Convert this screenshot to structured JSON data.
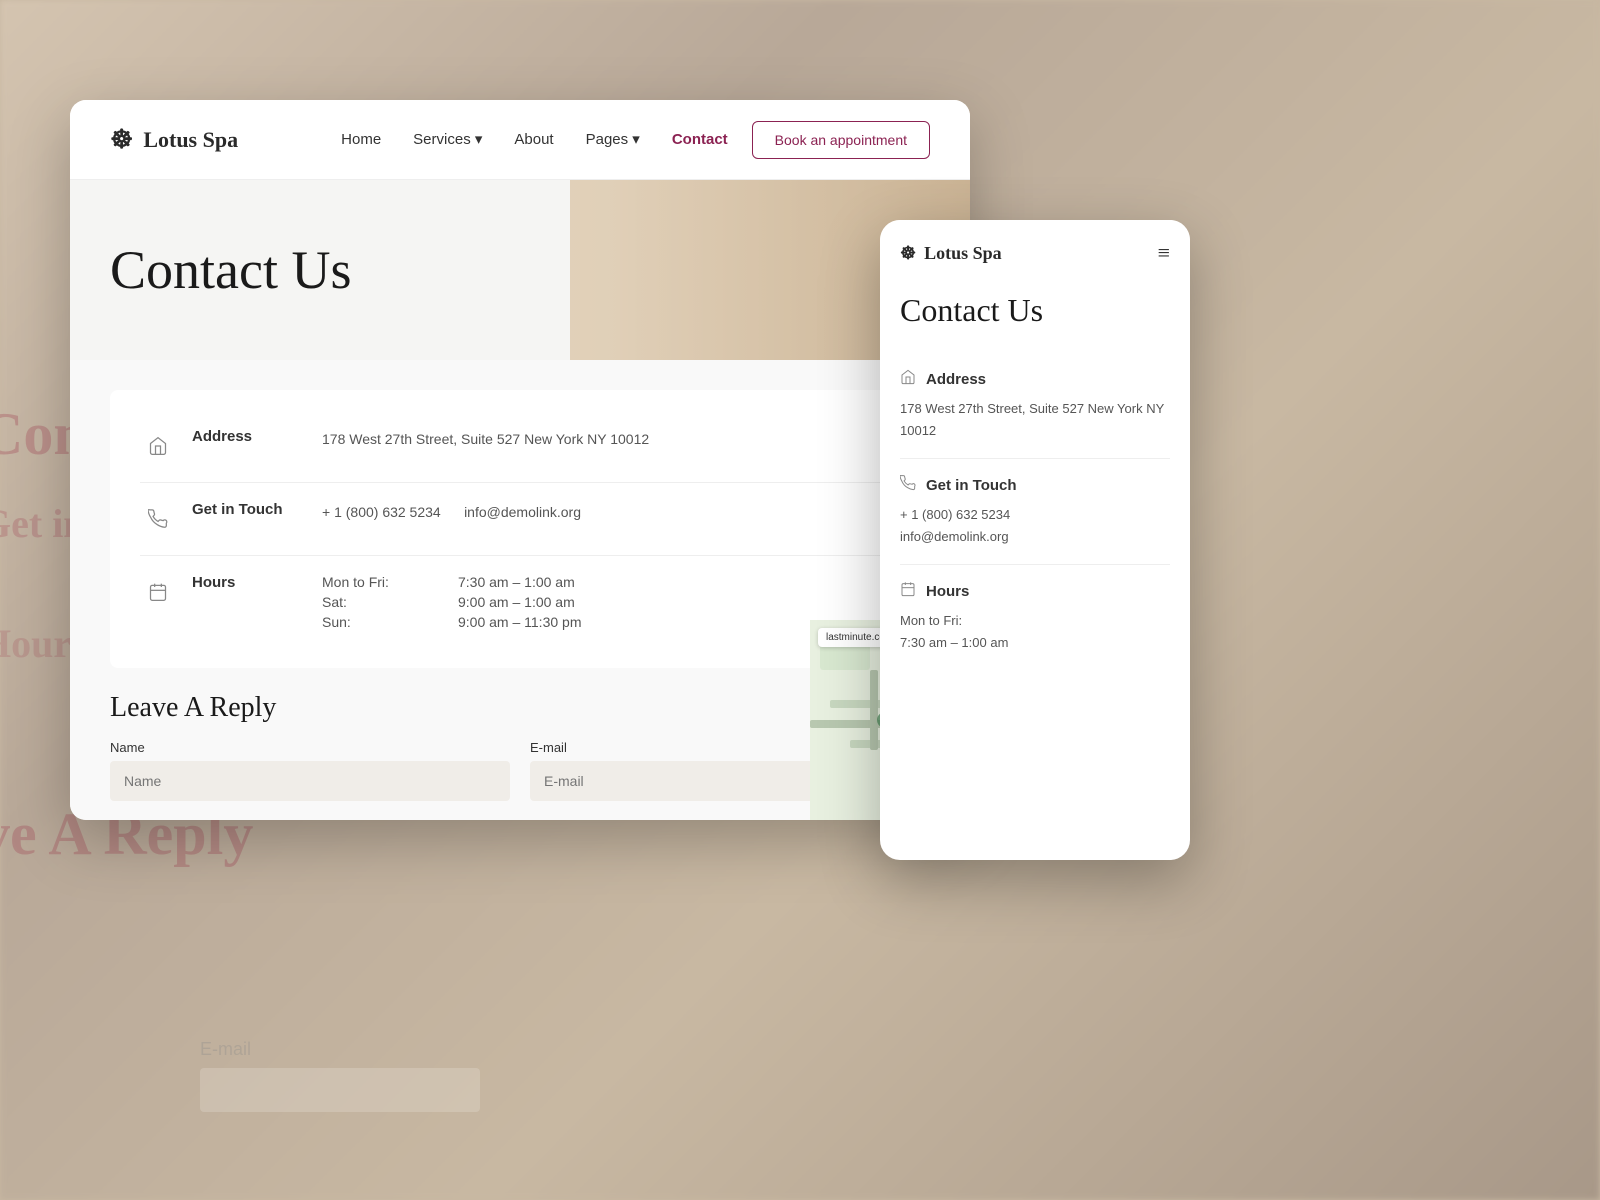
{
  "background": {
    "color": "#c8b8a2"
  },
  "desktop": {
    "nav": {
      "logo": "Lotus Spa",
      "links": [
        {
          "label": "Home",
          "active": false
        },
        {
          "label": "Services ▾",
          "active": false
        },
        {
          "label": "About",
          "active": false
        },
        {
          "label": "Pages ▾",
          "active": false
        },
        {
          "label": "Contact",
          "active": true
        }
      ],
      "cta": "Book an appointment"
    },
    "hero": {
      "title": "Contact Us"
    },
    "address": {
      "label": "Address",
      "value": "178 West 27th Street, Suite 527 New York NY 10012"
    },
    "getInTouch": {
      "label": "Get in Touch",
      "phone": "+ 1 (800) 632 5234",
      "email": "info@demolink.org"
    },
    "hours": {
      "label": "Hours",
      "rows": [
        {
          "day": "Mon to Fri:",
          "time": "7:30 am – 1:00 am"
        },
        {
          "day": "Sat:",
          "time": "9:00 am – 1:00 am"
        },
        {
          "day": "Sun:",
          "time": "9:00 am – 11:30 pm"
        }
      ]
    },
    "replySection": {
      "title": "Leave A Reply",
      "nameLabel": "Name",
      "namePlaceholder": "Name",
      "emailLabel": "E-mail",
      "emailPlaceholder": "E-mail"
    }
  },
  "mobile": {
    "logo": "Lotus Spa",
    "hero": {
      "title": "Contact Us"
    },
    "address": {
      "label": "Address",
      "value": "178 West 27th Street, Suite 527 New York NY 10012"
    },
    "getInTouch": {
      "label": "Get in Touch",
      "phone": "+ 1 (800) 632 5234",
      "email": "info@demolink.org"
    },
    "hours": {
      "label": "Hours",
      "monFri": "Mon to Fri:",
      "monFriTime": "7:30 am – 1:00 am"
    }
  },
  "icons": {
    "lotus": "☸",
    "home": "🏠",
    "phone": "📞",
    "clock": "🗓",
    "menu": "≡"
  }
}
